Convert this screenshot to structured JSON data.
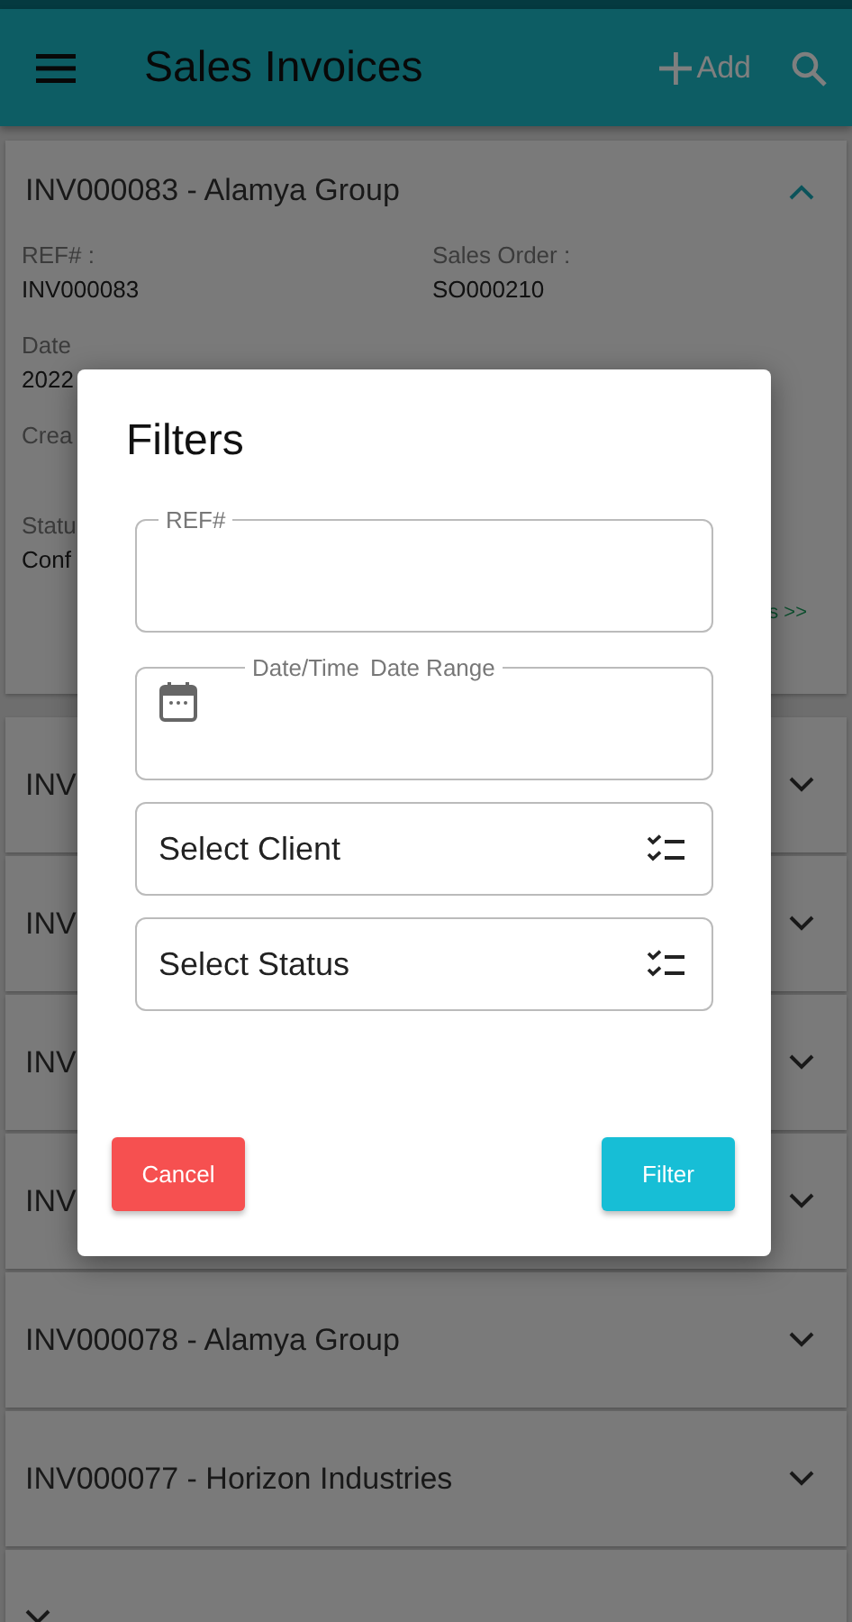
{
  "app_bar": {
    "title": "Sales Invoices",
    "add_label": "Add"
  },
  "invoices": [
    {
      "title": "INV000083 - Alamya Group",
      "expanded": true,
      "detail_rows": [
        [
          {
            "label": "REF# :",
            "value": "INV000083"
          },
          {
            "label": "Sales Order :",
            "value": "SO000210"
          }
        ],
        [
          {
            "label": "Date",
            "value": "2022"
          }
        ],
        [
          {
            "label": "Crea"
          }
        ],
        [
          {
            "label": "Statu",
            "value": "Conf"
          }
        ]
      ],
      "link": "s >>"
    },
    {
      "title": "INV",
      "expanded": false
    },
    {
      "title": "INV",
      "expanded": false
    },
    {
      "title": "INV",
      "expanded": false
    },
    {
      "title": "INV",
      "expanded": false
    },
    {
      "title": "INV000078 - Alamya Group",
      "expanded": false
    },
    {
      "title": "INV000077 - Horizon Industries",
      "expanded": false
    },
    {
      "expanded": false
    }
  ],
  "filter_dialog": {
    "title": "Filters",
    "fields": [
      {
        "kind": "text",
        "label": "REF#"
      },
      {
        "kind": "date",
        "label": "Date/Time",
        "hint": "Date Range"
      },
      {
        "kind": "select",
        "placeholder": "Select Client"
      },
      {
        "kind": "select",
        "placeholder": "Select Status"
      }
    ],
    "cancel": "Cancel",
    "submit": "Filter"
  }
}
